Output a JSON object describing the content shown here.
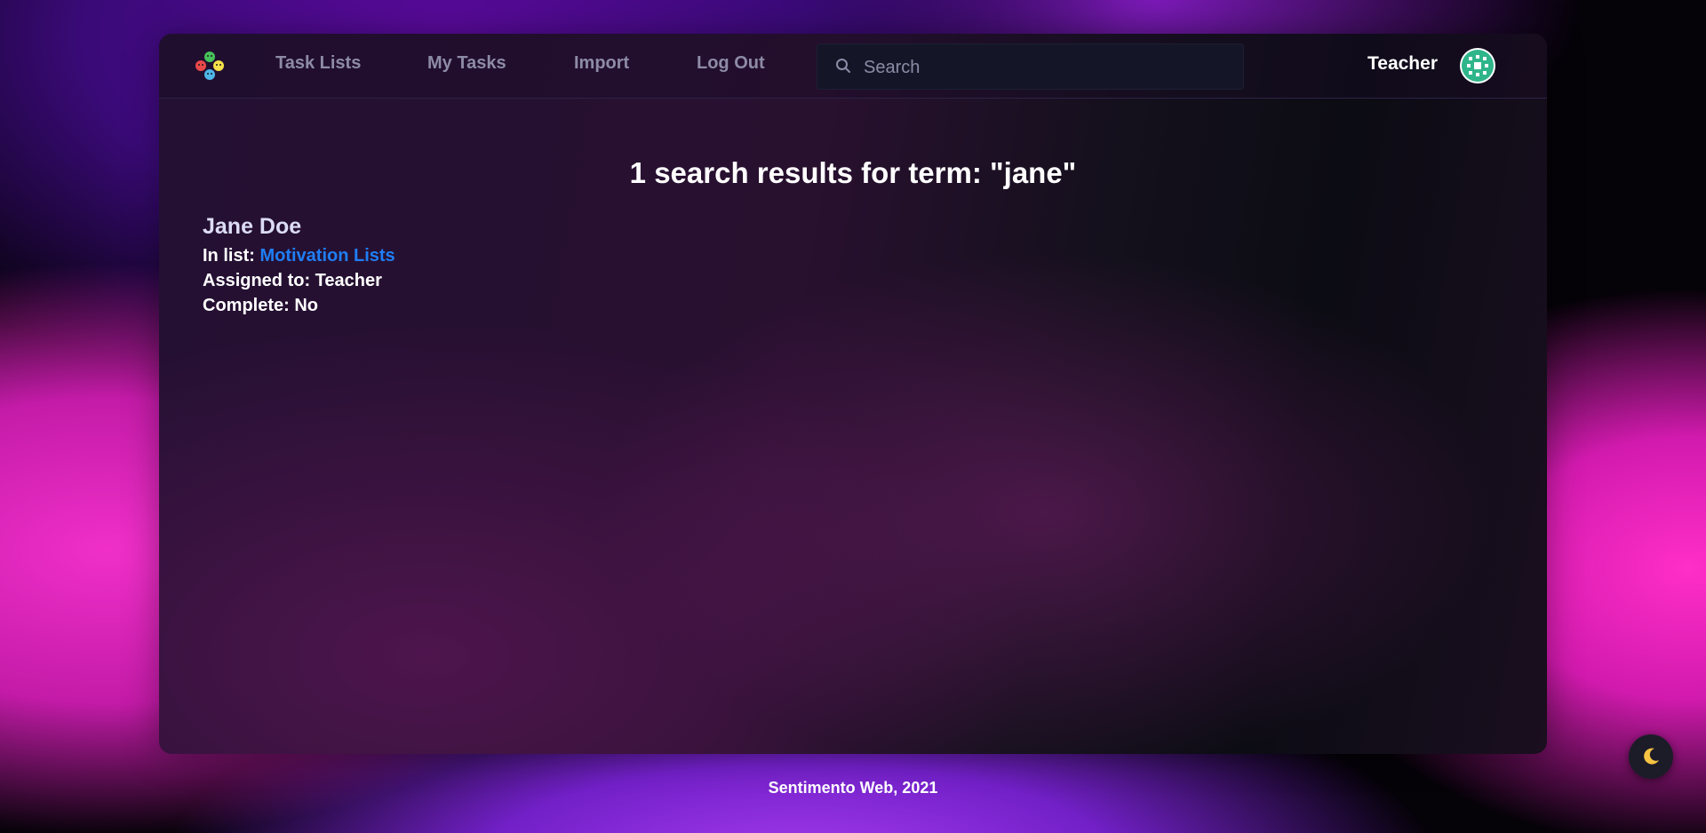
{
  "nav": {
    "links": [
      "Task Lists",
      "My Tasks",
      "Import",
      "Log Out"
    ],
    "user_name": "Teacher"
  },
  "search": {
    "placeholder": "Search",
    "value": ""
  },
  "results": {
    "title": "1 search results for term: \"jane\"",
    "items": [
      {
        "name": "Jane Doe",
        "list_label": "In list: ",
        "list_name": "Motivation Lists",
        "assigned_label": "Assigned to: ",
        "assigned_value": "Teacher",
        "complete_label": "Complete: ",
        "complete_value": "No"
      }
    ]
  },
  "footer": {
    "text": "Sentimento Web, 2021"
  },
  "icons": {
    "logo": "sentiment-faces-logo",
    "search": "search-icon",
    "avatar": "user-avatar",
    "theme": "moon-icon"
  },
  "colors": {
    "link": "#1f7ef5",
    "nav_text": "#8d8ba6",
    "moon": "#f6c343"
  }
}
